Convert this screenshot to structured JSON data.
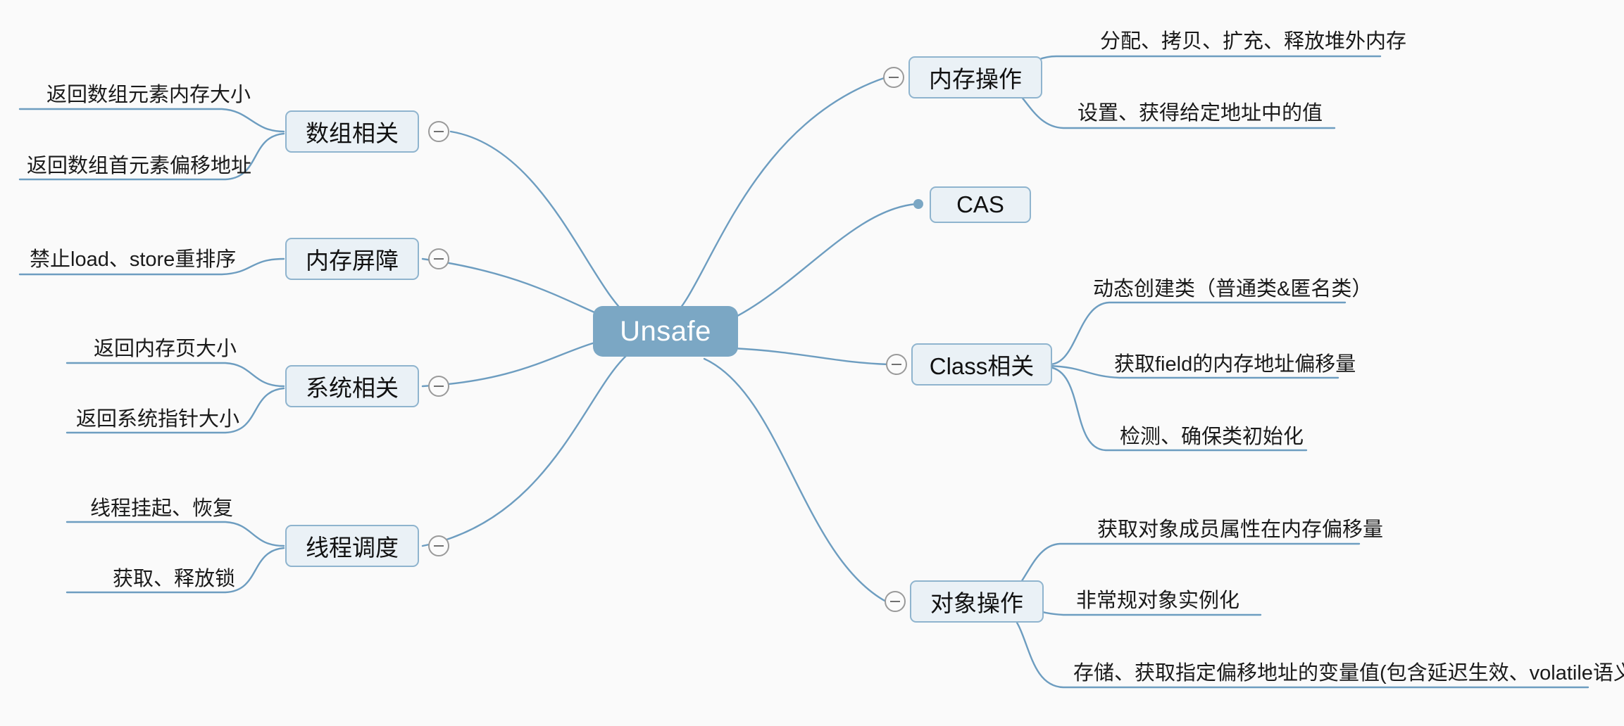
{
  "diagram": {
    "type": "mindmap",
    "title": "Unsafe",
    "background_color": "#fafafa",
    "root_color": "#7ba7c4",
    "branch_fill": "#eaf1f6",
    "branch_border": "#8fb4ce",
    "edge_color": "#6d9dc0",
    "root": {
      "label": "Unsafe"
    },
    "branches_right": [
      {
        "label": "内存操作",
        "toggle": "collapse-minus-icon",
        "children": [
          {
            "label": "分配、拷贝、扩充、释放堆外内存"
          },
          {
            "label": "设置、获得给定地址中的值"
          }
        ]
      },
      {
        "label": "CAS",
        "toggle": "leaf-dot-icon",
        "children": []
      },
      {
        "label": "Class相关",
        "toggle": "collapse-minus-icon",
        "children": [
          {
            "label": "动态创建类（普通类&匿名类）"
          },
          {
            "label": "获取field的内存地址偏移量"
          },
          {
            "label": "检测、确保类初始化"
          }
        ]
      },
      {
        "label": "对象操作",
        "toggle": "collapse-minus-icon",
        "children": [
          {
            "label": "获取对象成员属性在内存偏移量"
          },
          {
            "label": "非常规对象实例化"
          },
          {
            "label": "存储、获取指定偏移地址的变量值(包含延迟生效、volatile语义)"
          }
        ]
      }
    ],
    "branches_left": [
      {
        "label": "数组相关",
        "toggle": "collapse-minus-icon",
        "children": [
          {
            "label": "返回数组元素内存大小"
          },
          {
            "label": "返回数组首元素偏移地址"
          }
        ]
      },
      {
        "label": "内存屏障",
        "toggle": "collapse-minus-icon",
        "children": [
          {
            "label": "禁止load、store重排序"
          }
        ]
      },
      {
        "label": "系统相关",
        "toggle": "collapse-minus-icon",
        "children": [
          {
            "label": "返回内存页大小"
          },
          {
            "label": "返回系统指针大小"
          }
        ]
      },
      {
        "label": "线程调度",
        "toggle": "collapse-minus-icon",
        "children": [
          {
            "label": "线程挂起、恢复"
          },
          {
            "label": "获取、释放锁"
          }
        ]
      }
    ]
  }
}
